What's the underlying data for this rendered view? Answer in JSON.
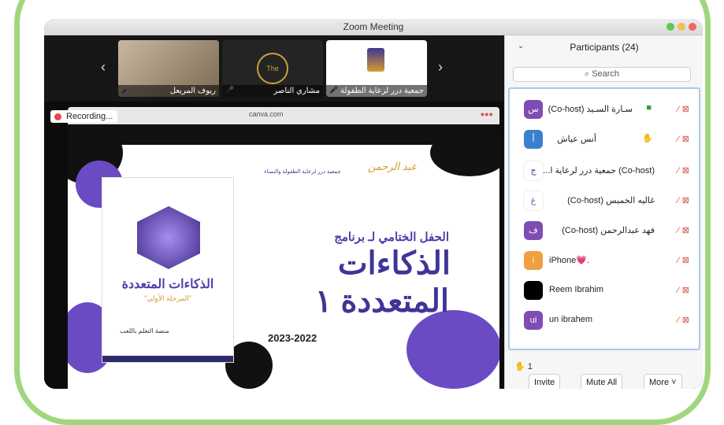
{
  "window": {
    "title": "Zoom Meeting"
  },
  "thumbnails": [
    {
      "name": "ريوف المريعل"
    },
    {
      "name": "مشاري الناصر"
    },
    {
      "name": "جمعية درر لرعاية الطفولة"
    }
  ],
  "recording": {
    "label": "Recording..."
  },
  "browser": {
    "url": "canva.com"
  },
  "slide": {
    "line1": "الحفل الختامي لـ برنامج",
    "line2": "الذكاءات",
    "line3": "المتعددة ١",
    "year": "2023-2022",
    "poster_title": "الذكاءات المتعددة",
    "poster_subtitle": "\"المرحلة الأولى\"",
    "poster_platform": "منصة التعلم باللعب"
  },
  "panel": {
    "title": "Participants (24)",
    "search_placeholder": "Search",
    "raised_count": "1",
    "buttons": {
      "invite": "Invite",
      "mute_all": "Mute All",
      "more": "More"
    }
  },
  "participants": [
    {
      "initial": "س",
      "name": "سـارة السـيد (Co-host)",
      "color": "#7e4db3"
    },
    {
      "initial": "أ",
      "name": "أنس عياش",
      "color": "#3b7fd0"
    },
    {
      "initial": "ج",
      "name": "(Co-host) جمعية درر لرعاية ا...",
      "color": "#ffffff"
    },
    {
      "initial": "غ",
      "name": "غاليه الخميس (Co-host)",
      "color": "#ffffff"
    },
    {
      "initial": "ف",
      "name": "فهد عبدالرحمن (Co-host)",
      "color": "#7e4db3"
    },
    {
      "initial": "i",
      "name": "iPhone💗.",
      "color": "#f0a040"
    },
    {
      "initial": "",
      "name": "Reem Ibrahim",
      "color": "#000000"
    },
    {
      "initial": "ui",
      "name": "un ibrahem",
      "color": "#7e4db3"
    }
  ]
}
